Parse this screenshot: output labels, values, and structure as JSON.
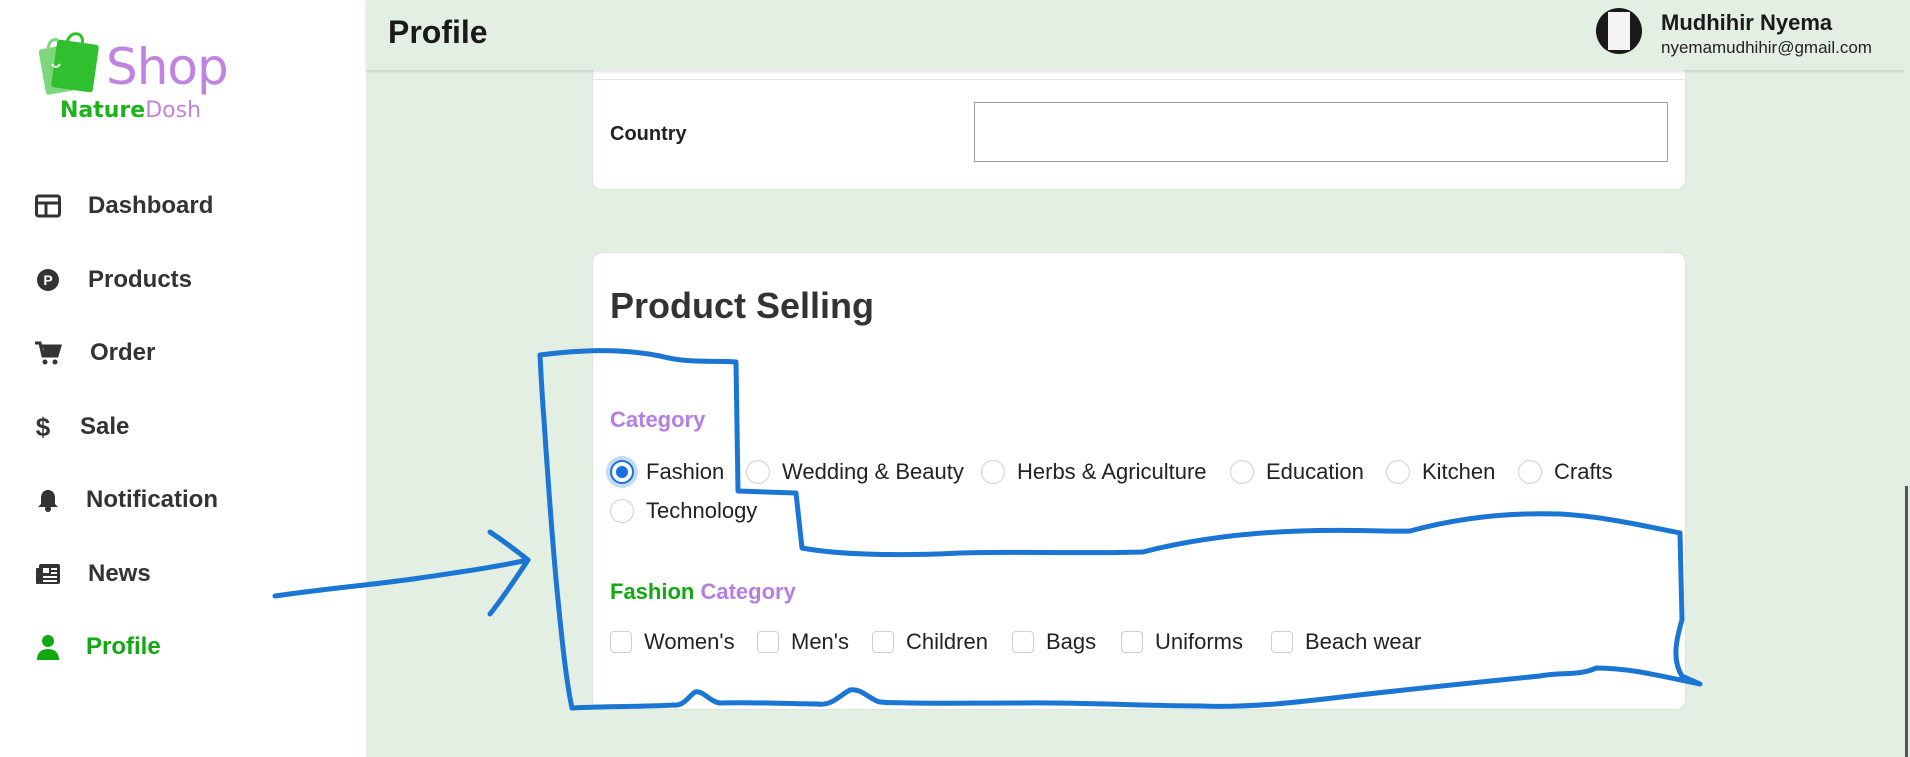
{
  "logo": {
    "shop": "Shop",
    "sub_green": "Nature",
    "sub_purple": "Dosh"
  },
  "sidebar": {
    "items": [
      {
        "label": "Dashboard",
        "icon": "dashboard-icon"
      },
      {
        "label": "Products",
        "icon": "products-p-icon"
      },
      {
        "label": "Order",
        "icon": "cart-icon"
      },
      {
        "label": "Sale",
        "icon": "dollar-icon"
      },
      {
        "label": "Notification",
        "icon": "bell-icon"
      },
      {
        "label": "News",
        "icon": "newspaper-icon"
      },
      {
        "label": "Profile",
        "icon": "user-icon",
        "active": true
      }
    ]
  },
  "header": {
    "title": "Profile",
    "user_name": "Mudhihir Nyema",
    "user_email": "nyemamudhihir@gmail.com"
  },
  "address": {
    "country_label": "Country",
    "country_value": ""
  },
  "product_selling": {
    "title": "Product Selling",
    "category_heading": "Category",
    "categories": [
      {
        "label": "Fashion",
        "checked": true
      },
      {
        "label": "Wedding & Beauty",
        "checked": false
      },
      {
        "label": "Herbs & Agriculture",
        "checked": false
      },
      {
        "label": "Education",
        "checked": false
      },
      {
        "label": "Kitchen",
        "checked": false
      },
      {
        "label": "Crafts",
        "checked": false
      },
      {
        "label": "Technology",
        "checked": false
      }
    ],
    "subcategory_heading_green": "Fashion",
    "subcategory_heading_purple": "Category",
    "subcategories": [
      {
        "label": "Women's",
        "checked": false
      },
      {
        "label": "Men's",
        "checked": false
      },
      {
        "label": "Children",
        "checked": false
      },
      {
        "label": "Bags",
        "checked": false
      },
      {
        "label": "Uniforms",
        "checked": false
      },
      {
        "label": "Beach wear",
        "checked": false
      }
    ]
  },
  "colors": {
    "accent_green": "#12a812",
    "accent_purple": "#b57ee0",
    "radio_blue": "#1672e0",
    "annotation_blue": "#1a76d2",
    "page_bg": "#e4efe4"
  }
}
